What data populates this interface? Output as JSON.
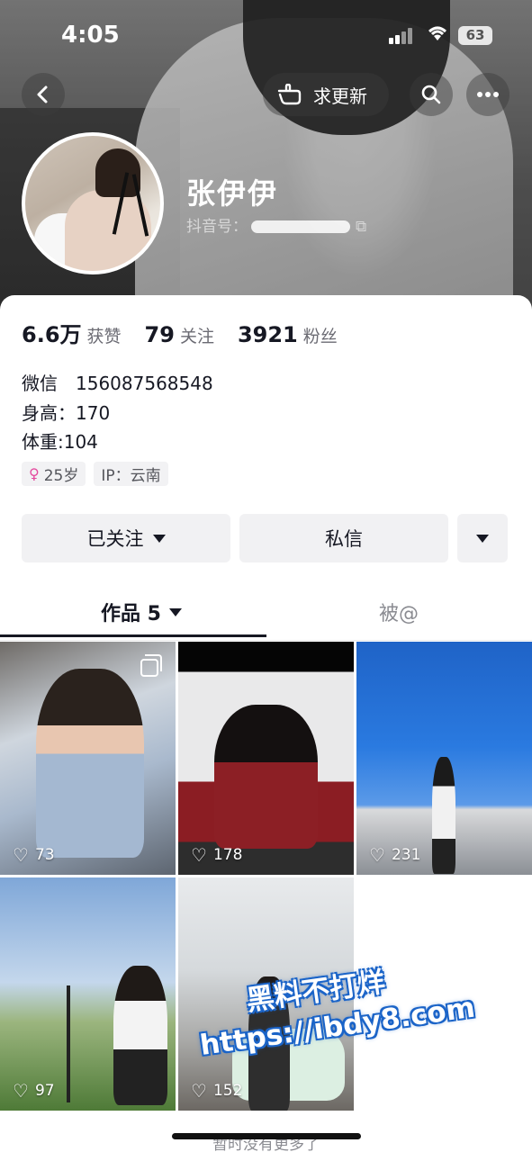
{
  "status_bar": {
    "time": "4:05",
    "battery": "63"
  },
  "header": {
    "update_label": "求更新"
  },
  "profile": {
    "name": "张伊伊",
    "douyin_id_label": "抖音号：",
    "stats": [
      {
        "value": "6.6万",
        "label": "获赞"
      },
      {
        "value": "79",
        "label": "关注"
      },
      {
        "value": "3921",
        "label": "粉丝"
      }
    ],
    "bio": {
      "line1": "微信　156087568548",
      "line2": "身高：170",
      "line3": "体重:104"
    },
    "tags": {
      "age": "25岁",
      "ip": "IP：云南"
    }
  },
  "actions": {
    "follow_label": "已关注",
    "dm_label": "私信"
  },
  "tabs": {
    "works_label": "作品 5",
    "mentions_label": "被@"
  },
  "videos": [
    {
      "likes": "73"
    },
    {
      "likes": "178"
    },
    {
      "likes": "231"
    },
    {
      "likes": "97"
    },
    {
      "likes": "152"
    }
  ],
  "watermark": {
    "line1": "黑料不打烊",
    "line2": "https://ibdy8.com"
  },
  "footer": {
    "text": "暂时没有更多了"
  },
  "colors": {
    "accent_pink": "#e44a9e",
    "watermark_blue": "#1b64c8"
  }
}
